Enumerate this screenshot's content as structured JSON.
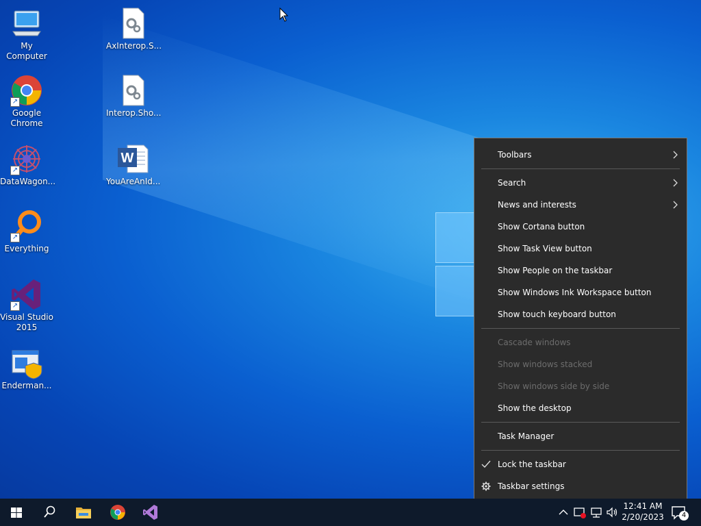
{
  "desktop": {
    "icons": [
      {
        "label": "My Computer"
      },
      {
        "label": "Google Chrome"
      },
      {
        "label": "DataWagon..."
      },
      {
        "label": "Everything"
      },
      {
        "label": "Visual Studio 2015"
      },
      {
        "label": "Enderman..."
      },
      {
        "label": "AxInterop.S..."
      },
      {
        "label": "Interop.Sho..."
      },
      {
        "label": "YouAreAnId..."
      }
    ]
  },
  "context_menu": {
    "items": [
      {
        "label": "Toolbars",
        "submenu": true,
        "enabled": true
      },
      {
        "label": "Search",
        "submenu": true,
        "enabled": true
      },
      {
        "label": "News and interests",
        "submenu": true,
        "enabled": true
      },
      {
        "label": "Show Cortana button",
        "enabled": true
      },
      {
        "label": "Show Task View button",
        "enabled": true
      },
      {
        "label": "Show People on the taskbar",
        "enabled": true
      },
      {
        "label": "Show Windows Ink Workspace button",
        "enabled": true
      },
      {
        "label": "Show touch keyboard button",
        "enabled": true
      },
      {
        "label": "Cascade windows",
        "enabled": false
      },
      {
        "label": "Show windows stacked",
        "enabled": false
      },
      {
        "label": "Show windows side by side",
        "enabled": false
      },
      {
        "label": "Show the desktop",
        "enabled": true
      },
      {
        "label": "Task Manager",
        "enabled": true
      },
      {
        "label": "Lock the taskbar",
        "checked": true,
        "enabled": true
      },
      {
        "label": "Taskbar settings",
        "icon": "gear-icon",
        "enabled": true
      }
    ]
  },
  "taskbar": {
    "pinned": [
      "start-icon",
      "search-icon",
      "file-explorer-icon",
      "chrome-icon",
      "visual-studio-icon"
    ],
    "tray": [
      "chevron-up-icon",
      "security-warning-icon",
      "network-icon",
      "volume-icon"
    ],
    "clock": {
      "time": "12:41 AM",
      "date": "2/20/2023"
    },
    "notifications": {
      "count": "4"
    }
  },
  "colors": {
    "menu_bg": "#2b2b2b",
    "taskbar_bg": "#0e1a2b",
    "accent": "#0a64d6"
  }
}
